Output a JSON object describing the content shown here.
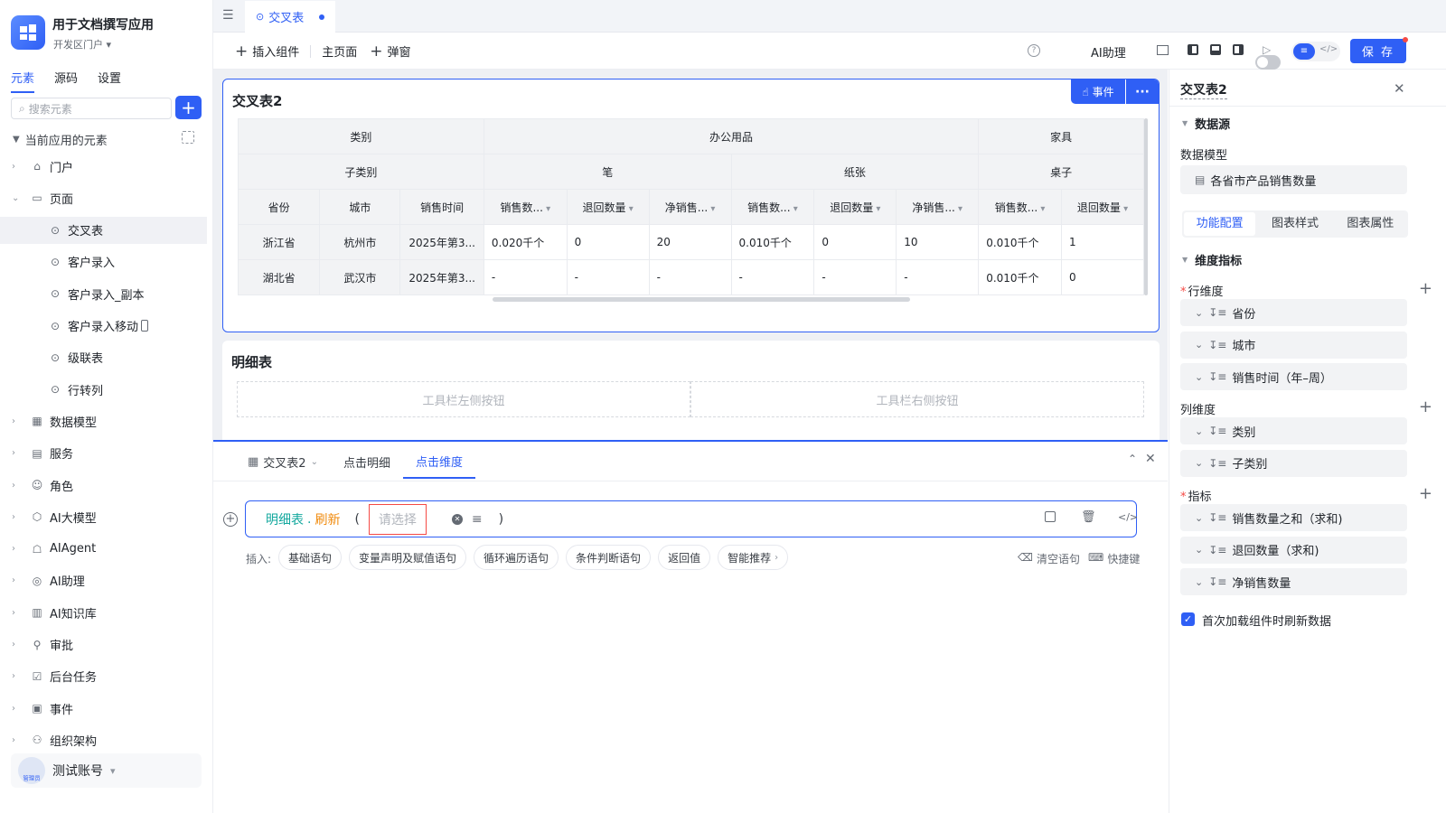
{
  "app": {
    "title": "用于文档撰写应用",
    "subtitle": "开发区门户"
  },
  "left_tabs": [
    "元素",
    "源码",
    "设置"
  ],
  "search": {
    "placeholder": "搜索元素"
  },
  "tree": {
    "header": "当前应用的元素",
    "items": [
      {
        "label": "门户",
        "icon": "home-icon"
      },
      {
        "label": "页面",
        "icon": "page-icon"
      },
      {
        "label": "交叉表",
        "icon": "page-link-icon",
        "sub": true
      },
      {
        "label": "客户录入",
        "icon": "page-link-icon",
        "sub": true
      },
      {
        "label": "客户录入_副本",
        "icon": "page-link-icon",
        "sub": true
      },
      {
        "label": "客户录入移动",
        "icon": "page-link-icon",
        "sub": true
      },
      {
        "label": "级联表",
        "icon": "page-link-icon",
        "sub": true
      },
      {
        "label": "行转列",
        "icon": "page-link-icon",
        "sub": true
      },
      {
        "label": "数据模型",
        "icon": "table-icon"
      },
      {
        "label": "服务",
        "icon": "service-icon"
      },
      {
        "label": "角色",
        "icon": "role-icon"
      },
      {
        "label": "AI大模型",
        "icon": "ai-model-icon"
      },
      {
        "label": "AIAgent",
        "icon": "robot-icon"
      },
      {
        "label": "AI助理",
        "icon": "ai-assistant-icon"
      },
      {
        "label": "AI知识库",
        "icon": "book-icon"
      },
      {
        "label": "审批",
        "icon": "approval-icon"
      },
      {
        "label": "后台任务",
        "icon": "task-icon"
      },
      {
        "label": "事件",
        "icon": "event-icon"
      },
      {
        "label": "组织架构",
        "icon": "org-icon"
      }
    ]
  },
  "account": {
    "name": "测试账号",
    "badge": "管理员"
  },
  "file_tab": {
    "label": "交叉表"
  },
  "toolbar": {
    "insert": "插入组件",
    "home": "主页面",
    "popup": "弹窗",
    "ai": "AI助理",
    "save": "保 存"
  },
  "crosstab": {
    "title": "交叉表2",
    "event_btn": "事件",
    "head1": {
      "cat": "类别",
      "office": "办公用品",
      "furniture": "家具"
    },
    "head2": {
      "sub": "子类别",
      "pen": "笔",
      "paper": "纸张",
      "desk": "桌子"
    },
    "head3": [
      "省份",
      "城市",
      "销售时间",
      "销售数...",
      "退回数量",
      "净销售...",
      "销售数...",
      "退回数量",
      "净销售...",
      "销售数...",
      "退回数量"
    ],
    "rows": [
      [
        "浙江省",
        "杭州市",
        "2025年第3...",
        "0.020千个",
        "0",
        "20",
        "0.010千个",
        "0",
        "10",
        "0.010千个",
        "1"
      ],
      [
        "湖北省",
        "武汉市",
        "2025年第3...",
        "-",
        "-",
        "-",
        "-",
        "-",
        "-",
        "0.010千个",
        "0"
      ]
    ]
  },
  "detail": {
    "title": "明细表",
    "left_ph": "工具栏左侧按钮",
    "right_ph": "工具栏右侧按钮"
  },
  "event_panel": {
    "tabs": [
      "交叉表2",
      "点击明细",
      "点击维度"
    ],
    "expr": {
      "obj": "明细表",
      "dot": ".",
      "method": "刷新",
      "open": "(",
      "placeholder": "请选择",
      "close": ")"
    },
    "insert_label": "插入:",
    "chips": [
      "基础语句",
      "变量声明及赋值语句",
      "循环遍历语句",
      "条件判断语句",
      "返回值",
      "智能推荐"
    ],
    "clear": "清空语句",
    "shortcut": "快捷键"
  },
  "right_panel": {
    "title": "交叉表2",
    "datasource": "数据源",
    "model_label": "数据模型",
    "model_value": "各省市产品销售数量",
    "tabs": [
      "功能配置",
      "图表样式",
      "图表属性"
    ],
    "dim_section": "维度指标",
    "row_dim_label": "行维度",
    "row_dims": [
      "省份",
      "城市",
      "销售时间（年–周）"
    ],
    "col_dim_label": "列维度",
    "col_dims": [
      "类别",
      "子类别"
    ],
    "metric_label": "指标",
    "metrics": [
      "销售数量之和（求和)",
      "退回数量（求和)",
      "净销售数量"
    ],
    "checkbox": "首次加载组件时刷新数据",
    "checkbox_checked": true
  }
}
